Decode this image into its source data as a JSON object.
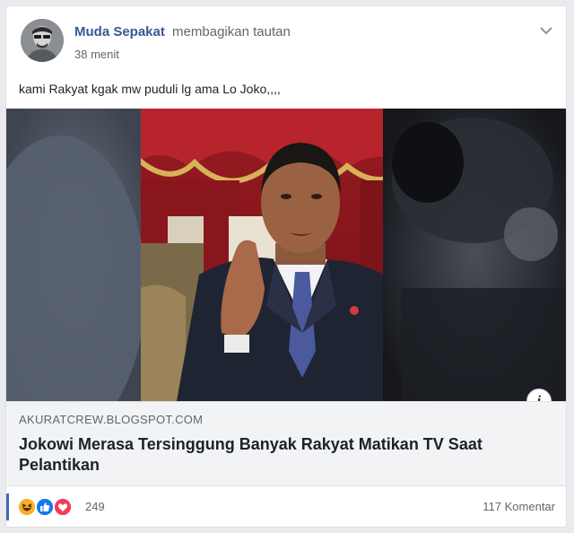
{
  "post": {
    "author": "Muda Sepakat",
    "action": "membagikan tautan",
    "time": "38 menit",
    "text": "kami Rakyat kgak mw puduli lg ama Lo Joko,,,,"
  },
  "link": {
    "domain": "AKURATCREW.BLOGSPOT.COM",
    "title": "Jokowi Merasa Tersinggung Banyak Rakyat Matikan TV Saat Pelantikan",
    "info_glyph": "i"
  },
  "footer": {
    "reaction_count": "249",
    "comments": "117 Komentar",
    "reactions": [
      "haha-icon",
      "like-icon",
      "love-icon"
    ]
  },
  "colors": {
    "author_link": "#365899",
    "like_blue": "#1877f2",
    "love_red": "#f33e58",
    "haha_yellow": "#f7b125"
  }
}
